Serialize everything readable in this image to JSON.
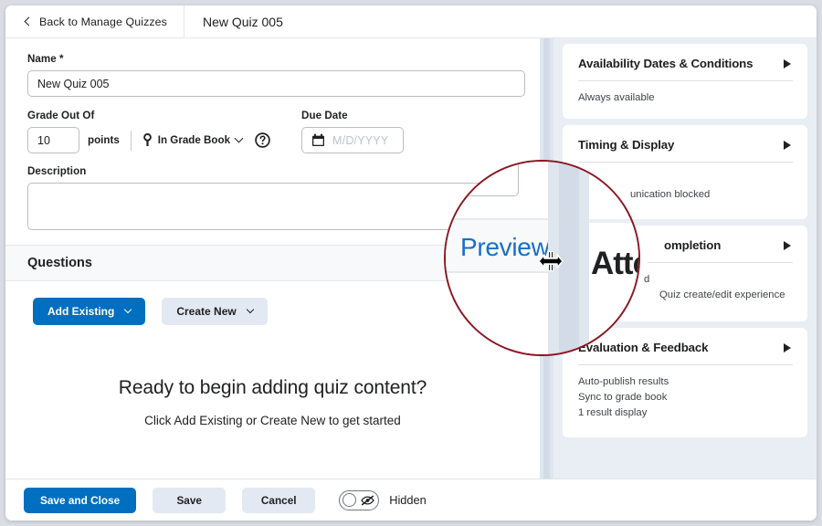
{
  "topbar": {
    "back_label": "Back to Manage Quizzes",
    "back_icon": "chevron-left-icon",
    "quiz_title": "New Quiz 005"
  },
  "form": {
    "name_label": "Name *",
    "name_value": "New Quiz 005",
    "grade_out_of_label": "Grade Out Of",
    "points_value": "10",
    "points_unit": "points",
    "gradebook_label": "In Grade Book",
    "gradebook_icon": "key-icon",
    "help_icon": "help-circle-icon",
    "due_date_label": "Due Date",
    "due_date_value": "",
    "due_date_placeholder": "M/D/YYYY",
    "calendar_icon": "calendar-icon",
    "description_label": "Description",
    "description_value": ""
  },
  "questions": {
    "section_title": "Questions",
    "add_existing_label": "Add Existing",
    "create_new_label": "Create New",
    "empty_title": "Ready to begin adding quiz content?",
    "empty_subtitle": "Click Add Existing or Create New to get started"
  },
  "sidebar": {
    "cards": [
      {
        "title": "Availability Dates & Conditions",
        "expand_icon": "triangle-right-icon",
        "lines": [
          "Always available"
        ]
      },
      {
        "title": "Timing & Display",
        "expand_icon": "triangle-right-icon",
        "lines": [
          "",
          "unication blocked"
        ]
      },
      {
        "title": "Attempts & Completion",
        "title_visible_fragment": "ompletion",
        "expand_icon": "triangle-right-icon",
        "lines": [
          "d",
          "Quiz create/edit experience"
        ]
      },
      {
        "title": "Evaluation & Feedback",
        "expand_icon": "triangle-right-icon",
        "lines": [
          "Auto-publish results",
          "Sync to grade book",
          "1 result display"
        ]
      }
    ]
  },
  "bottombar": {
    "save_and_close_label": "Save and Close",
    "save_label": "Save",
    "cancel_label": "Cancel",
    "visibility_toggle_state": "off",
    "visibility_label": "Hidden",
    "visibility_icon": "eye-off-icon"
  },
  "magnifier": {
    "preview_text": "Preview",
    "attempts_fragment": "Atte",
    "cursor_icon": "resize-horizontal-cursor",
    "ring_color": "#8c1622"
  }
}
